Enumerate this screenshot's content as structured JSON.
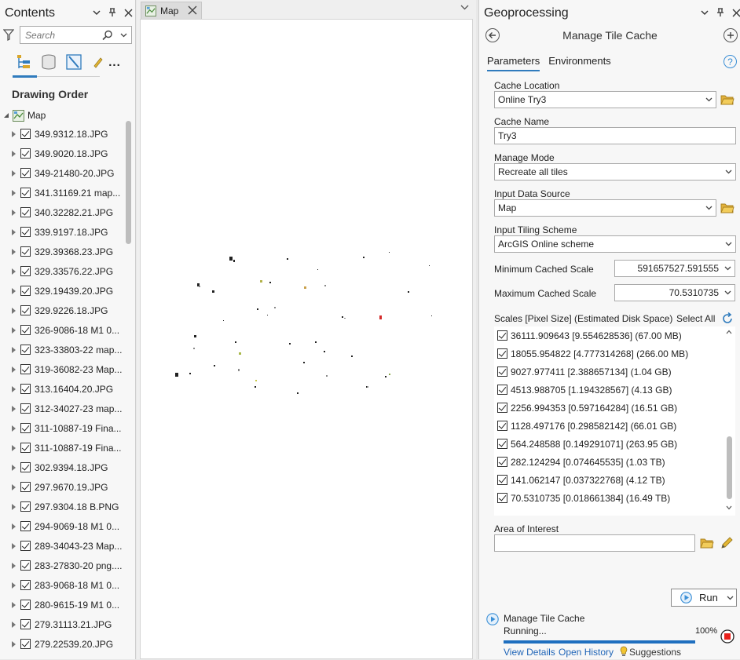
{
  "contents": {
    "title": "Contents",
    "search_placeholder": "Search",
    "drawing_order_label": "Drawing Order",
    "map_label": "Map",
    "more_label": "...",
    "layers": [
      "349.9312.18.JPG",
      "349.9020.18.JPG",
      "349-21480-20.JPG",
      "341.31169.21 map...",
      "340.32282.21.JPG",
      "339.9197.18.JPG",
      "329.39368.23.JPG",
      "329.33576.22.JPG",
      "329.19439.20.JPG",
      "329.9226.18.JPG",
      "326-9086-18 M1 0...",
      "323-33803-22 map...",
      "319-36082-23 Map...",
      "313.16404.20.JPG",
      "312-34027-23 map...",
      "311-10887-19 Fina...",
      "311-10887-19 Fina...",
      "302.9394.18.JPG",
      "297.9670.19.JPG",
      "297.9304.18 B.PNG",
      "294-9069-18 M1 0...",
      "289-34043-23 Map...",
      "283-27830-20 png....",
      "283-9068-18 M1 0...",
      "280-9615-19 M1 0...",
      "279.31113.21.JPG",
      "279.22539.20.JPG"
    ]
  },
  "map_view": {
    "tab_label": "Map"
  },
  "geoprocessing": {
    "title": "Geoprocessing",
    "tool_name": "Manage Tile Cache",
    "tabs": [
      "Parameters",
      "Environments"
    ],
    "help_label": "?",
    "cache_location": {
      "label": "Cache Location",
      "value": "Online Try3"
    },
    "cache_name": {
      "label": "Cache Name",
      "value": "Try3"
    },
    "manage_mode": {
      "label": "Manage Mode",
      "value": "Recreate all tiles"
    },
    "input_data_source": {
      "label": "Input Data Source",
      "value": "Map"
    },
    "input_tiling_scheme": {
      "label": "Input Tiling Scheme",
      "value": "ArcGIS Online scheme"
    },
    "min_scale": {
      "label": "Minimum Cached Scale",
      "value": "591657527.591555"
    },
    "max_scale": {
      "label": "Maximum Cached Scale",
      "value": "70.5310735"
    },
    "scales": {
      "label": "Scales [Pixel Size] (Estimated Disk Space)",
      "select_all": "Select All",
      "items": [
        "36111.909643 [9.554628536] (67.00 MB)",
        "18055.954822 [4.777314268] (266.00 MB)",
        "9027.977411 [2.388657134] (1.04 GB)",
        "4513.988705 [1.194328567] (4.13 GB)",
        "2256.994353 [0.597164284] (16.51 GB)",
        "1128.497176 [0.298582142] (66.01 GB)",
        "564.248588 [0.149291071] (263.95 GB)",
        "282.124294 [0.074645535] (1.03 TB)",
        "141.062147 [0.037322768] (4.12 TB)",
        "70.5310735 [0.018661384] (16.49 TB)"
      ]
    },
    "area_of_interest": {
      "label": "Area of Interest",
      "value": ""
    },
    "run_label": "Run",
    "status": {
      "tool_name": "Manage Tile Cache",
      "state": "Running...",
      "percent_text": "100%",
      "progress": 1.0,
      "view_details": "View Details",
      "open_history": "Open History",
      "suggestions": "Suggestions"
    }
  },
  "colors": {
    "accent": "#2f7bbd",
    "link": "#2166b8",
    "progress": "#1f6fbf",
    "stop": "#e8201b",
    "folder": "#d9a62a"
  }
}
